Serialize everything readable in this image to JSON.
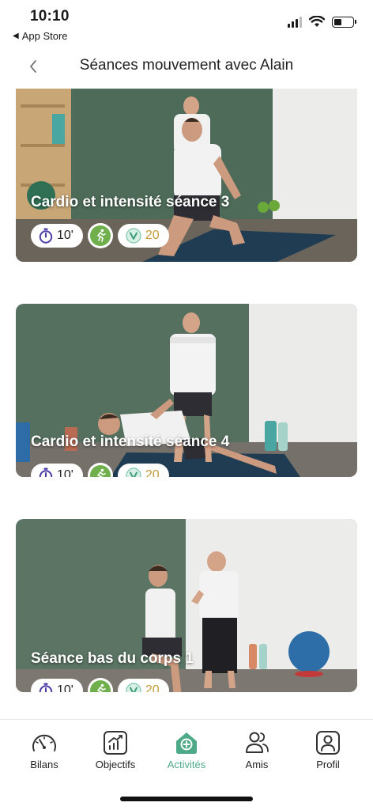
{
  "status_bar": {
    "time": "10:10",
    "back_app": "App Store",
    "signal_icon": "cellular-signal-icon",
    "wifi_icon": "wifi-icon",
    "battery_icon": "battery-icon"
  },
  "header": {
    "back_icon": "chevron-left-icon",
    "title": "Séances mouvement avec Alain"
  },
  "sessions": [
    {
      "title": "Cardio et intensité séance 3",
      "duration": "10'",
      "category_icon": "running-person-icon",
      "points": "20",
      "brand_watermark": "vipali"
    },
    {
      "title": "Cardio et intensité séance 4",
      "duration": "10'",
      "category_icon": "running-person-icon",
      "points": "20",
      "brand_watermark": "vipali"
    },
    {
      "title": "Séance bas du corps 1",
      "duration": "10'",
      "category_icon": "running-person-icon",
      "points": "20",
      "brand_watermark": "vipali"
    }
  ],
  "tabbar": {
    "items": [
      {
        "label": "Bilans",
        "icon": "gauge-icon",
        "active": false
      },
      {
        "label": "Objectifs",
        "icon": "chart-up-icon",
        "active": false
      },
      {
        "label": "Activités",
        "icon": "home-plus-icon",
        "active": true
      },
      {
        "label": "Amis",
        "icon": "users-icon",
        "active": false
      },
      {
        "label": "Profil",
        "icon": "profile-icon",
        "active": false
      }
    ]
  },
  "colors": {
    "accent": "#4caa88",
    "points_text": "#c39a3a",
    "wall_green": "#4b6b57"
  }
}
